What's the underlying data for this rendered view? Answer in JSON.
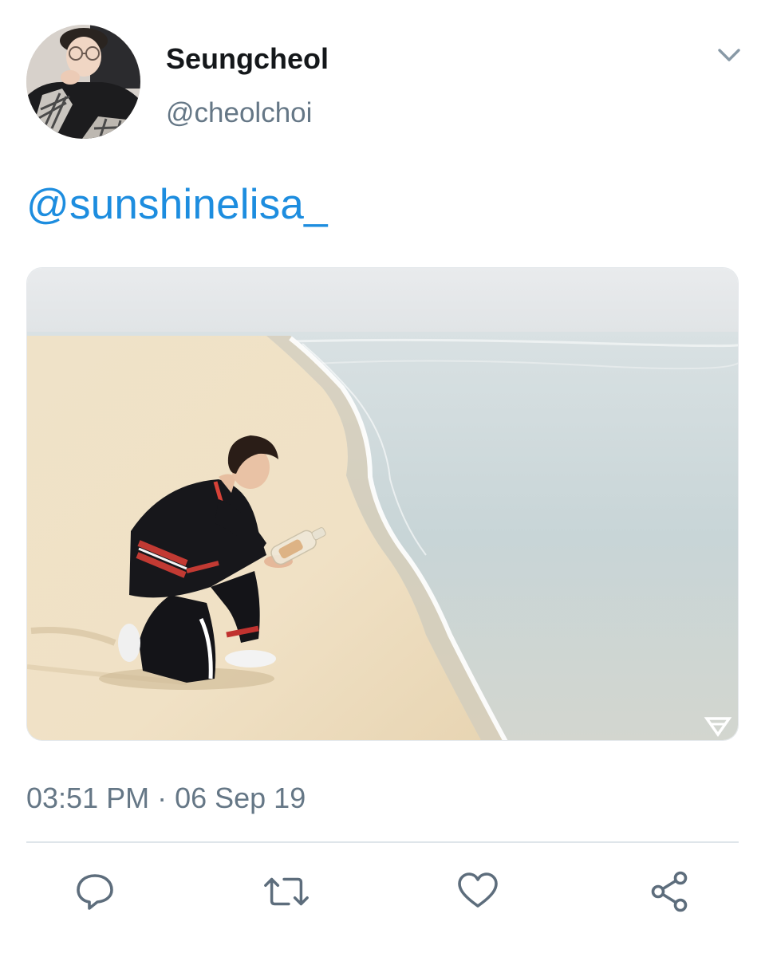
{
  "tweet": {
    "author": {
      "display_name": "Seungcheol",
      "handle": "@cheolchoi"
    },
    "text": "@sunshinelisa_",
    "timestamp": "03:51 PM · 06 Sep 19"
  },
  "media": {
    "watermark_icon": "seventeen-logo-icon"
  },
  "actions": [
    {
      "icon": "reply-icon"
    },
    {
      "icon": "retweet-icon"
    },
    {
      "icon": "like-icon"
    },
    {
      "icon": "share-icon"
    }
  ],
  "colors": {
    "link": "#1d8ddf",
    "secondary_text": "#657786",
    "primary_text": "#14171a",
    "icon": "#5d6d7c"
  }
}
